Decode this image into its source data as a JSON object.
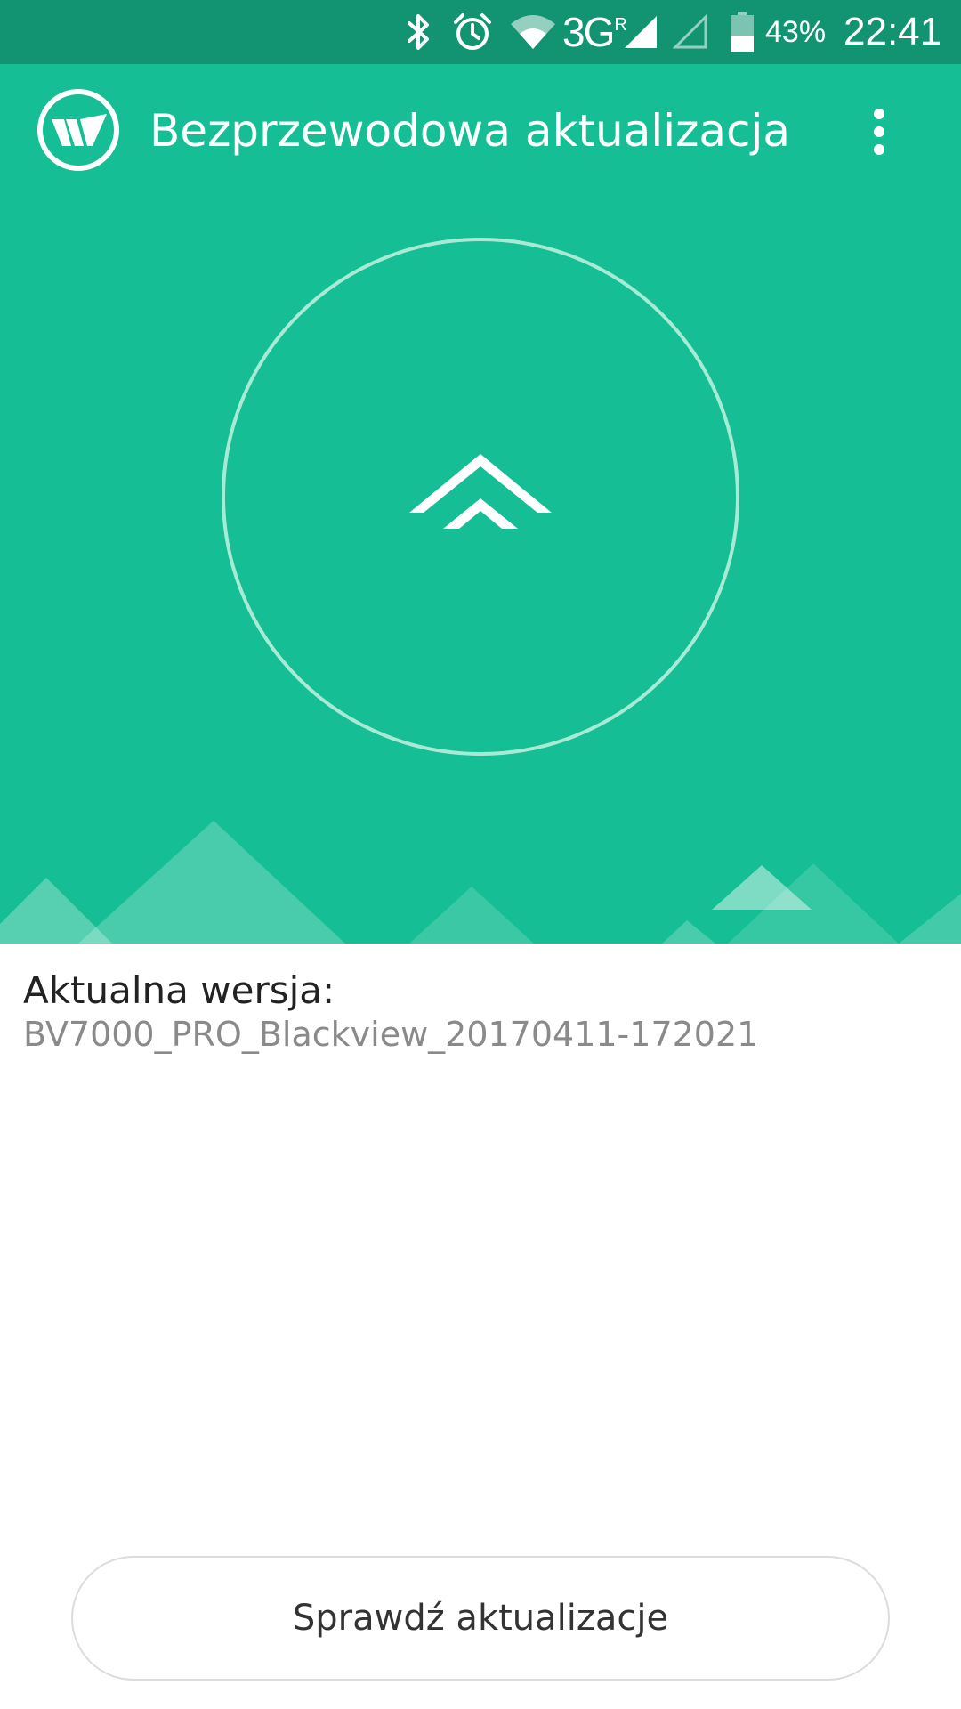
{
  "status_bar": {
    "network_label": "3G",
    "roaming_label": "R",
    "battery_percent": "43%",
    "battery_level": 0.43,
    "time": "22:41",
    "icons": [
      "bluetooth-icon",
      "alarm-icon",
      "wifi-icon",
      "signal-icon",
      "signal-empty-icon",
      "battery-icon"
    ]
  },
  "header": {
    "title": "Bezprzewodowa aktualizacja",
    "logo_icon": "wireless-update-logo-icon",
    "menu_icon": "more-vertical-icon"
  },
  "hero": {
    "center_icon": "double-chevron-up-icon",
    "background_color": "#15be94"
  },
  "version": {
    "label": "Aktualna wersja:",
    "value": "BV7000_PRO_Blackview_20170411-172021"
  },
  "actions": {
    "check_label": "Sprawdź aktualizacje"
  },
  "colors": {
    "accent": "#15be94",
    "status_bar": "#129473",
    "text_primary": "#222222",
    "text_secondary": "#8a8a8a"
  }
}
